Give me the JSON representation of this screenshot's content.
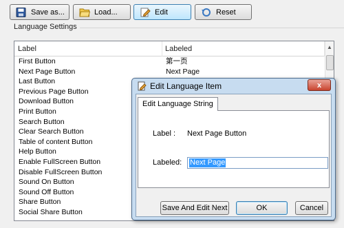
{
  "toolbar": {
    "save_label": "Save as...",
    "load_label": "Load...",
    "edit_label": "Edit",
    "reset_label": "Reset"
  },
  "group_title": "Language Settings",
  "table": {
    "col_label": "Label",
    "col_labeled": "Labeled",
    "rows": [
      {
        "label": "First Button",
        "labeled": "第一页"
      },
      {
        "label": "Next Page Button",
        "labeled": "Next Page"
      },
      {
        "label": "Last Button",
        "labeled": ""
      },
      {
        "label": "Previous Page Button",
        "labeled": ""
      },
      {
        "label": "Download Button",
        "labeled": ""
      },
      {
        "label": "Print Button",
        "labeled": ""
      },
      {
        "label": "Search Button",
        "labeled": ""
      },
      {
        "label": "Clear Search Button",
        "labeled": ""
      },
      {
        "label": "Table of content Button",
        "labeled": ""
      },
      {
        "label": "Help Button",
        "labeled": ""
      },
      {
        "label": "Enable FullScreen Button",
        "labeled": ""
      },
      {
        "label": "Disable FullScreen Button",
        "labeled": ""
      },
      {
        "label": "Sound On Button",
        "labeled": ""
      },
      {
        "label": "Sound Off Button",
        "labeled": ""
      },
      {
        "label": "Share Button",
        "labeled": ""
      },
      {
        "label": "Social Share Button",
        "labeled": ""
      }
    ]
  },
  "dialog": {
    "title": "Edit Language Item",
    "close_glyph": "x",
    "tab_label": "Edit Language String",
    "label_caption": "Label :",
    "label_value": "Next Page Button",
    "labeled_caption": "Labeled:",
    "labeled_value": "Next Page",
    "save_edit_next_label": "Save And Edit Next",
    "ok_label": "OK",
    "cancel_label": "Cancel"
  },
  "icons": {
    "save": "floppy-disk-icon",
    "load": "folder-open-icon",
    "edit": "edit-pencil-icon",
    "reset": "reset-arrow-icon",
    "dialog": "edit-document-icon"
  }
}
